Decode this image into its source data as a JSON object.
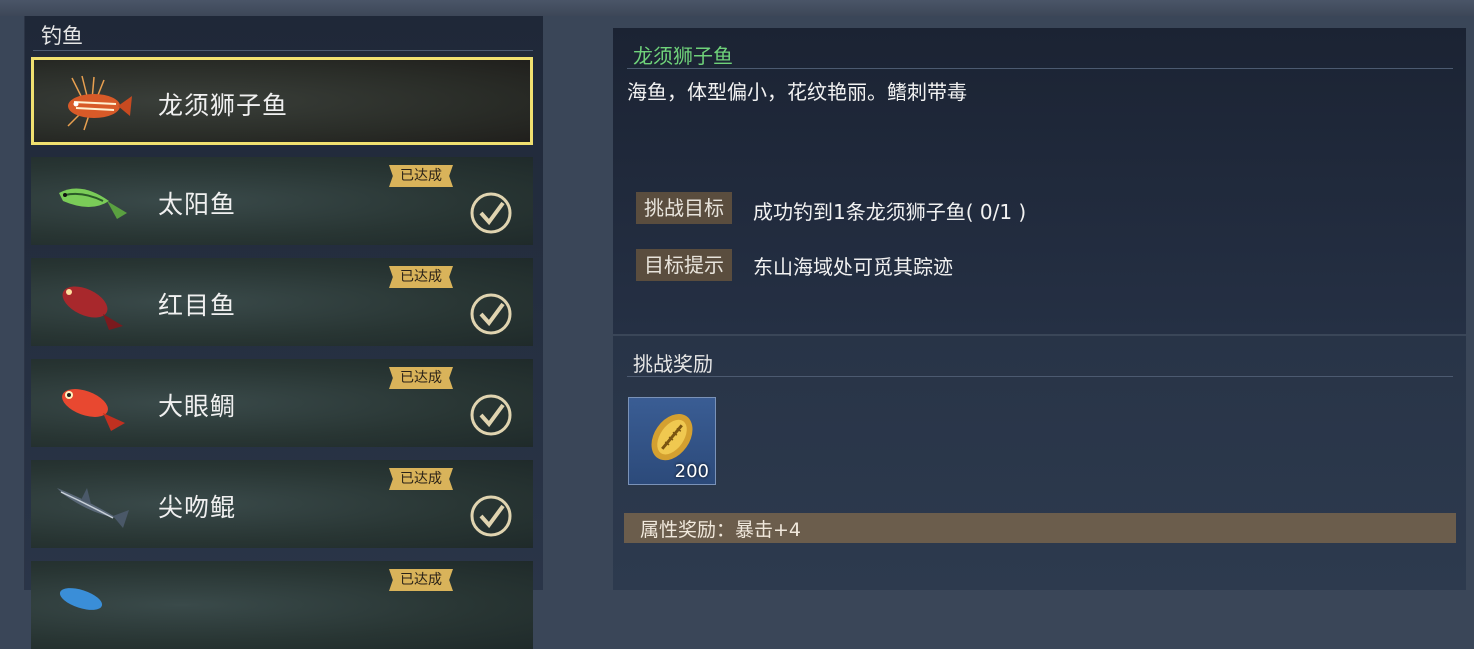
{
  "left": {
    "title": "钓鱼",
    "done_label": "已达成",
    "items": [
      {
        "name": "龙须狮子鱼",
        "selected": true,
        "done": false,
        "icon": "lionfish-icon"
      },
      {
        "name": "太阳鱼",
        "selected": false,
        "done": true,
        "icon": "sunfish-icon"
      },
      {
        "name": "红目鱼",
        "selected": false,
        "done": true,
        "icon": "redeye-fish-icon"
      },
      {
        "name": "大眼鲷",
        "selected": false,
        "done": true,
        "icon": "bigeye-fish-icon"
      },
      {
        "name": "尖吻鲲",
        "selected": false,
        "done": true,
        "icon": "shark-icon"
      },
      {
        "name": "",
        "selected": false,
        "done": true,
        "icon": "blue-fish-icon"
      }
    ]
  },
  "detail": {
    "title": "龙须狮子鱼",
    "description": "海鱼，体型偏小，花纹艳丽。鳍刺带毒",
    "goal_label": "挑战目标",
    "goal_value": "成功钓到1条龙须狮子鱼( 0/1 )",
    "hint_label": "目标提示",
    "hint_value": "东山海域处可觅其踪迹"
  },
  "reward": {
    "title": "挑战奖励",
    "item_icon": "golden-shell-icon",
    "item_count": "200",
    "attr_text": "属性奖励：暴击+4"
  },
  "colors": {
    "selected_border": "#f0e070",
    "title_green": "#6fd27a",
    "badge_gold": "#d9b35a"
  }
}
